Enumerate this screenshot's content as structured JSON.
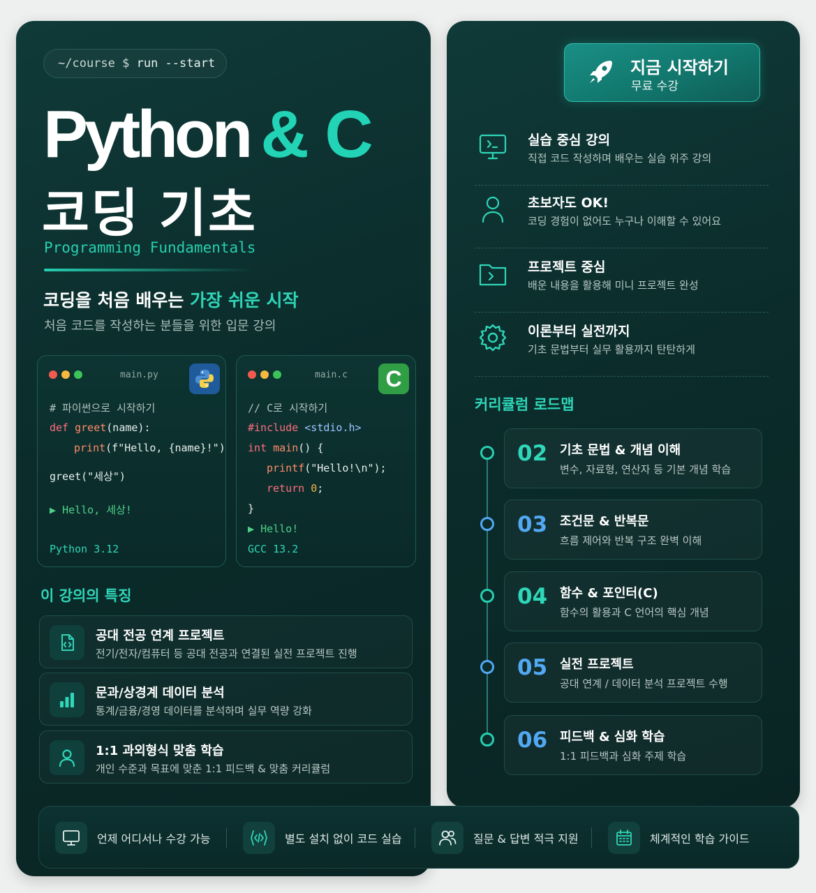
{
  "colors": {
    "accent": "#2fd6b8",
    "panel": "#0b2c2b",
    "python_logo": "#1f5b9a",
    "c_logo": "#2f9e44"
  },
  "terminal": {
    "prompt": "~/course $",
    "command": "run --start"
  },
  "title": {
    "python": "Python",
    "amp_c": "& C",
    "korean": "코딩 기초",
    "subtitle": "Programming Fundamentals"
  },
  "tagline": {
    "lead": "코딩을 처음 배우는",
    "accent": "가장 쉬운 시작",
    "sub": "처음 코드를 작성하는 분들을 위한 입문 강의"
  },
  "python_card": {
    "filename": "main.py",
    "logo_icon": "python-logo-icon",
    "line1": "# 파이썬으로 시작하기",
    "line2_kw": "def",
    "line2_fn": "greet",
    "line2_rest": "(name):",
    "line3_fn": "print",
    "line3_rest": "(f\"Hello, {name}!\")",
    "line4": "greet(\"세상\")",
    "output": "Hello, 세상!",
    "version": "Python 3.12"
  },
  "c_card": {
    "filename": "main.c",
    "logo_letter": "C",
    "line1": "// C로 시작하기",
    "line2_kw": "#include",
    "line2_hdr": "<stdio.h>",
    "line3_kw": "int",
    "line3_fn": "main",
    "line3_rest": "() {",
    "line4_fn": "printf",
    "line4_rest": "(\"Hello!\\n\");",
    "line5_kw": "return",
    "line5_num": "0",
    "line5_rest": ";",
    "line6": "}",
    "output": "Hello!",
    "version": "GCC 13.2"
  },
  "features": {
    "title": "이 강의의 특징",
    "items": [
      {
        "icon": "code-file-icon",
        "title": "공대 전공 연계 프로젝트",
        "desc": "전기/전자/컴퓨터 등 공대 전공과 연결된 실전 프로젝트 진행"
      },
      {
        "icon": "bar-chart-icon",
        "title": "문과/상경계 데이터 분석",
        "desc": "통계/금융/경영 데이터를 분석하며 실무 역량 강화"
      },
      {
        "icon": "user-icon",
        "title": "1:1 과외형식 맞춤 학습",
        "desc": "개인 수준과 목표에 맞춘 1:1 피드백 & 맞춤 커리큘럼"
      }
    ]
  },
  "start_button": {
    "icon": "rocket-icon",
    "title": "지금 시작하기",
    "sub": "무료 수강"
  },
  "right_features": [
    {
      "icon": "monitor-code-icon",
      "title": "실습 중심 강의",
      "desc": "직접 코드 작성하며 배우는 실습 위주 강의"
    },
    {
      "icon": "user-icon",
      "title": "초보자도 OK!",
      "desc": "코딩 경험이 없어도 누구나 이해할 수 있어요"
    },
    {
      "icon": "folder-code-icon",
      "title": "프로젝트 중심",
      "desc": "배운 내용을 활용해 미니 프로젝트 완성"
    },
    {
      "icon": "gear-icon",
      "title": "이론부터 실전까지",
      "desc": "기초 문법부터 실무 활용까지 탄탄하게"
    }
  ],
  "roadmap": {
    "title": "커리큘럼 로드맵",
    "items": [
      {
        "num": "02",
        "title": "기초 문법 & 개념 이해",
        "desc": "변수, 자료형, 연산자 등 기본 개념 학습",
        "color": "#2fd6b8"
      },
      {
        "num": "03",
        "title": "조건문 & 반복문",
        "desc": "흐름 제어와 반복 구조 완벽 이해",
        "color": "#52a8f2"
      },
      {
        "num": "04",
        "title": "함수 & 포인터(C)",
        "desc": "함수의 활용과 C 언어의 핵심 개념",
        "color": "#2fd6b8"
      },
      {
        "num": "05",
        "title": "실전 프로젝트",
        "desc": "공대 연계 / 데이터 분석 프로젝트 수행",
        "color": "#52a8f2"
      },
      {
        "num": "06",
        "title": "피드백 & 심화 학습",
        "desc": "1:1 피드백과 심화 주제 학습",
        "color": "#52a8f2"
      }
    ]
  },
  "bottom_bar": [
    {
      "icon": "monitor-icon",
      "label": "언제 어디서나 수강 가능"
    },
    {
      "icon": "code-icon",
      "label": "별도 설치 없이 코드 실습"
    },
    {
      "icon": "users-icon",
      "label": "질문 & 답변 적극 지원"
    },
    {
      "icon": "calendar-icon",
      "label": "체계적인 학습 가이드"
    }
  ]
}
